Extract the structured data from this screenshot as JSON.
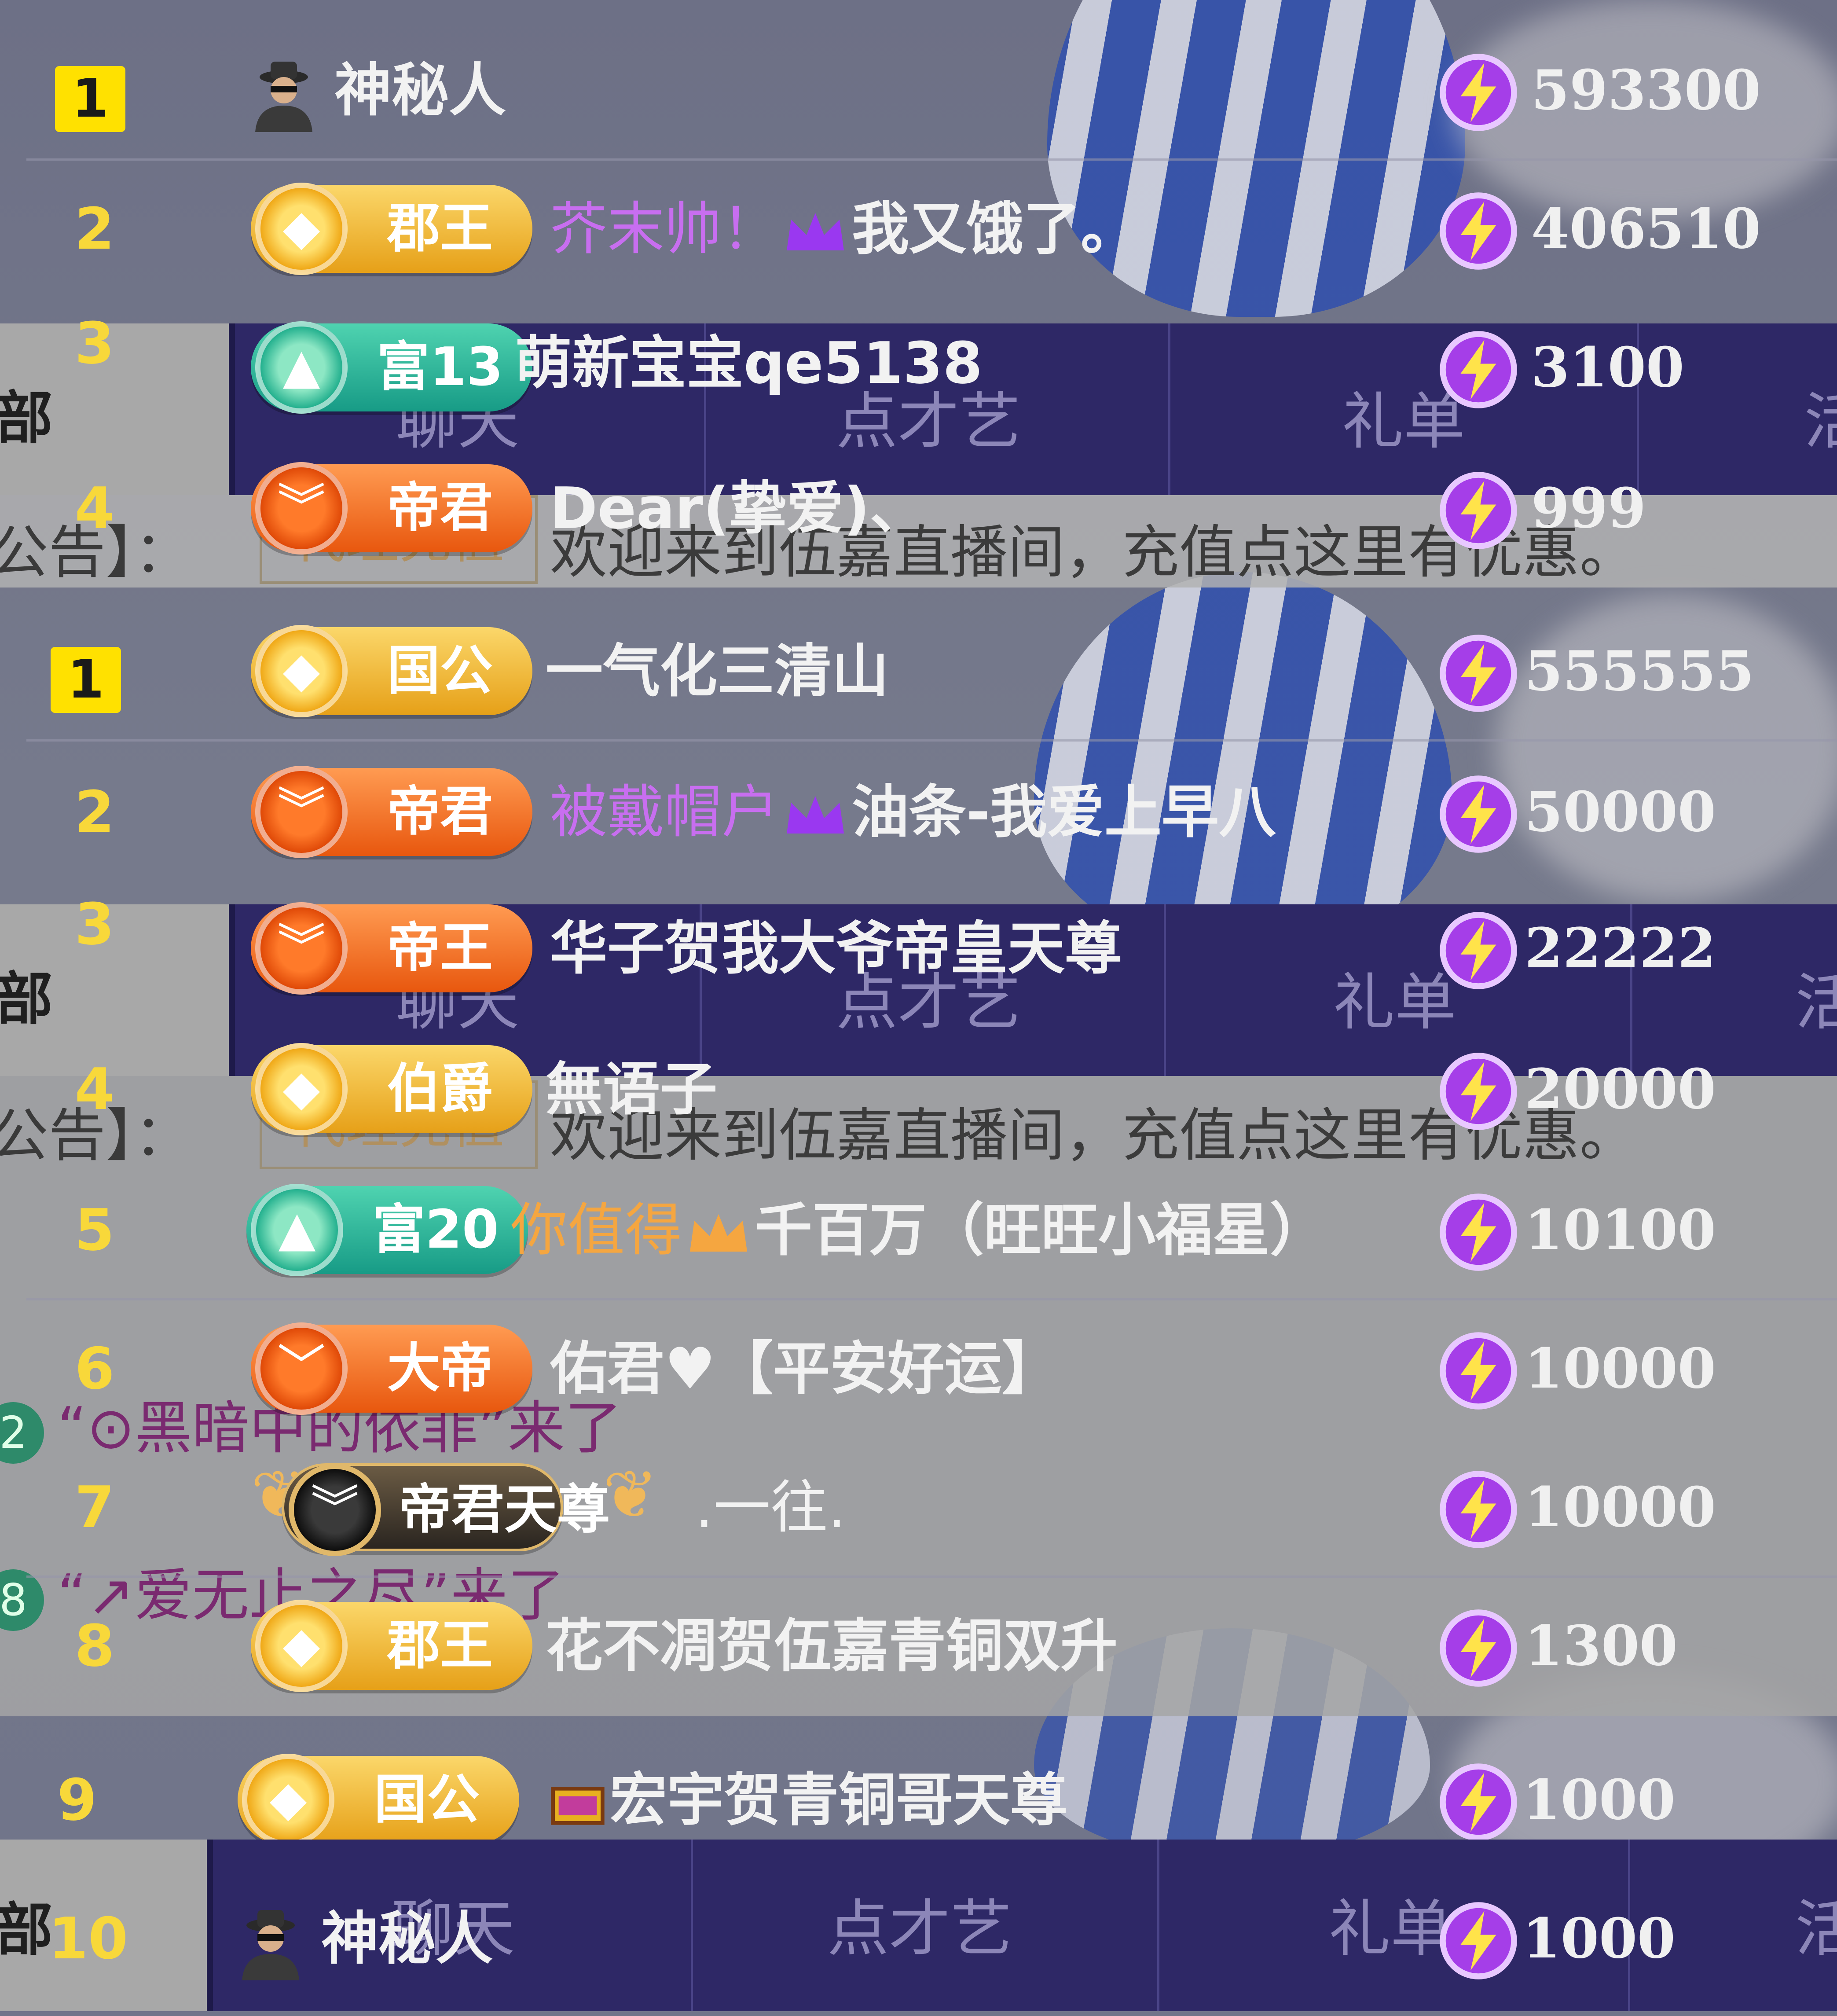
{
  "nav": {
    "side_label": "部",
    "tabs": [
      "聊天",
      "点才艺",
      "礼单",
      "活"
    ]
  },
  "notice": {
    "prefix": "公告】：",
    "recharge": "代理充值",
    "message": "欢迎来到伍嘉直播间，充值点这里有优惠。"
  },
  "entry_messages": [
    {
      "level": "2",
      "text": "“⊙黑暗中的依菲”来了"
    },
    {
      "level": "8",
      "text": "“↗爱无止之尽”来了"
    }
  ],
  "panel1": [
    {
      "rank": "1",
      "badge": "",
      "name": "神秘人",
      "score": "593300"
    },
    {
      "rank": "2",
      "badge": "郡王",
      "prefix": "芥末帅！",
      "name": "我又饿了。",
      "score": "406510"
    },
    {
      "rank": "3",
      "badge": "富13",
      "name": "萌新宝宝qe5138",
      "score": "3100"
    },
    {
      "rank": "4",
      "badge": "帝君",
      "name": "Dear(挚爱)、",
      "score": "999"
    }
  ],
  "panel2": [
    {
      "rank": "1",
      "badge": "国公",
      "name": "一气化三清山",
      "score": "555555"
    },
    {
      "rank": "2",
      "badge": "帝君",
      "prefix": "被戴帽户",
      "name": "油条-我爱上早八",
      "score": "50000"
    },
    {
      "rank": "3",
      "badge": "帝王",
      "name": "华子贺我大爷帝皇天尊",
      "score": "22222"
    },
    {
      "rank": "4",
      "badge": "伯爵",
      "name": "無语子",
      "score": "20000"
    },
    {
      "rank": "5",
      "badge": "富20",
      "prefix": "你值得",
      "name": "千百万（旺旺小福星）",
      "score": "10100"
    },
    {
      "rank": "6",
      "badge": "大帝",
      "name": "佑君♥【平安好运】",
      "score": "10000"
    },
    {
      "rank": "7",
      "badge": "帝君天尊",
      "name": ".一往.",
      "score": "10000"
    },
    {
      "rank": "8",
      "badge": "郡王",
      "name": "花不凋贺伍嘉青铜双升",
      "score": "1300"
    },
    {
      "rank": "9",
      "badge": "国公",
      "name": "宏宇贺青铜哥天尊",
      "score": "1000"
    },
    {
      "rank": "10",
      "badge": "",
      "name": "神秘人",
      "score": "1000"
    }
  ],
  "colors": {
    "rank_yellow": "#f8d83a",
    "top_rank_bg": "#ffe100",
    "navbar_bg": "#2e2866",
    "prefix_purple": "#c86ef0",
    "prefix_orange": "#f5a640"
  },
  "icons": [
    "spy-avatar-icon",
    "lightning-bolt-icon",
    "crown-icon",
    "treasure-chest-icon",
    "medal-coin-icon"
  ]
}
